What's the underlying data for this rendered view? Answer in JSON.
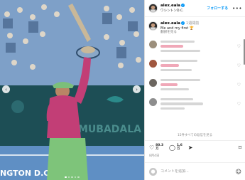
{
  "post": {
    "username": "alex.eala",
    "subtitle": "ワシントンD.C.",
    "follow_label": "フォローする",
    "more_label": "•••",
    "verified_mark": "✓"
  },
  "caption": {
    "username": "alex.eala",
    "time": "1週間前",
    "text": "Me and my first 🏆",
    "translate": "翻訳を見る"
  },
  "comments": {
    "view_replies": "15件すべての返信を見る"
  },
  "actions": {
    "like_count": "80.3",
    "like_unit": "万",
    "comment_count": "1,6",
    "comment_unit": "万"
  },
  "date": "8月4日",
  "add_comment": {
    "placeholder": "コメントを追加..."
  },
  "photo": {
    "banner_text": "MUBADALA",
    "court_text": "NGTON D.C."
  },
  "carousel": {
    "total": 5,
    "active": 1
  },
  "icons": {
    "prev": "‹",
    "next": "›",
    "heart": "♡",
    "comment": "◯",
    "share": "➤",
    "bookmark": "⌑",
    "emoji": "☺",
    "user": "●"
  },
  "colors": {
    "accent": "#0095f6",
    "kit": "#c23e76",
    "skirt": "#7ec47a"
  }
}
